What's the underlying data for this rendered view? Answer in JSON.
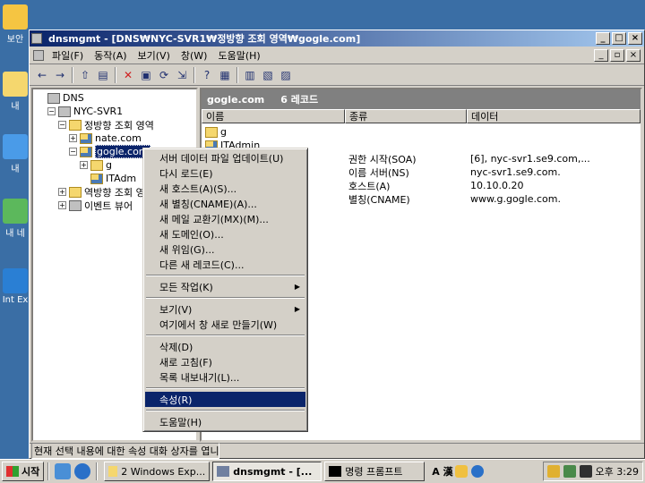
{
  "desktop": {
    "icons": [
      {
        "label": "보안",
        "color": "#f5c542"
      },
      {
        "label": "내",
        "color": "#f5d76e"
      },
      {
        "label": "내 ",
        "color": "#4a9be8"
      },
      {
        "label": "내 네",
        "color": "#5cb85c"
      },
      {
        "label": "Int Ex",
        "color": "#2a7fd4"
      }
    ]
  },
  "window": {
    "title": "dnsmgmt - [DNS₩NYC-SVR1₩정방향 조회 영역₩gogle.com]",
    "buttons": [
      "_",
      "□",
      "×"
    ]
  },
  "menubar": {
    "items": [
      "파일(F)",
      "동작(A)",
      "보기(V)",
      "창(W)",
      "도움말(H)"
    ],
    "mdi_buttons": [
      "_",
      "▫",
      "×"
    ]
  },
  "toolbar": {
    "icons": [
      "back-icon",
      "forward-icon",
      "up-folder-icon",
      "show-tree-icon",
      "delete-icon",
      "properties-icon",
      "refresh-icon",
      "export-icon",
      "help-icon",
      "console-icon",
      "server-icon",
      "records-icon",
      "zone-icon"
    ],
    "glyphs": [
      "←",
      "→",
      "⇧",
      "▤",
      "✕",
      "▣",
      "⟳",
      "⇲",
      "?",
      "▦",
      "▥",
      "▧",
      "▨"
    ],
    "separators_after": [
      1,
      3,
      7,
      9
    ]
  },
  "tree": {
    "nodes": [
      {
        "label": "DNS",
        "indent": 0,
        "expander": "",
        "icon": "dns-root-icon"
      },
      {
        "label": "NYC-SVR1",
        "indent": 1,
        "expander": "−",
        "icon": "server-icon"
      },
      {
        "label": "정방향 조회 영역",
        "indent": 2,
        "expander": "−",
        "icon": "folder-icon"
      },
      {
        "label": "nate.com",
        "indent": 3,
        "expander": "+",
        "icon": "zone-icon"
      },
      {
        "label": "gogle.com",
        "indent": 3,
        "expander": "−",
        "icon": "zone-icon",
        "selected": true
      },
      {
        "label": "g",
        "indent": 4,
        "expander": "+",
        "icon": "folder-icon"
      },
      {
        "label": "ITAdm",
        "indent": 4,
        "expander": "",
        "icon": "zone-icon"
      },
      {
        "label": "역방향 조회 영",
        "indent": 2,
        "expander": "+",
        "icon": "folder-icon"
      },
      {
        "label": "이벤트 뷰어",
        "indent": 2,
        "expander": "+",
        "icon": "event-viewer-icon"
      }
    ]
  },
  "right_pane": {
    "header_name": "gogle.com",
    "header_count": "6 레코드",
    "columns": [
      "이름",
      "종류",
      "데이터"
    ],
    "rows": [
      {
        "name": "g",
        "type": "",
        "data": "",
        "icon": "folder-icon"
      },
      {
        "name": "ITAdmin",
        "type": "",
        "data": "",
        "icon": "zone-icon"
      },
      {
        "name": "",
        "type": "권한 시작(SOA)",
        "data": "[6], nyc-svr1.se9.com,...",
        "icon": ""
      },
      {
        "name": "",
        "type": "이름 서버(NS)",
        "data": "nyc-svr1.se9.com.",
        "icon": ""
      },
      {
        "name": "",
        "type": "호스트(A)",
        "data": "10.10.0.20",
        "icon": ""
      },
      {
        "name": "",
        "type": "별칭(CNAME)",
        "data": "www.g.gogle.com.",
        "icon": ""
      }
    ]
  },
  "context_menu": {
    "groups": [
      [
        {
          "label": "서버 데이터 파일 업데이트(U)"
        },
        {
          "label": "다시 로드(E)"
        },
        {
          "label": "새 호스트(A)(S)..."
        },
        {
          "label": "새 별칭(CNAME)(A)..."
        },
        {
          "label": "새 메일 교환기(MX)(M)..."
        },
        {
          "label": "새 도메인(O)..."
        },
        {
          "label": "새 위임(G)..."
        },
        {
          "label": "다른 새 레코드(C)..."
        }
      ],
      [
        {
          "label": "모든 작업(K)",
          "submenu": true
        }
      ],
      [
        {
          "label": "보기(V)",
          "submenu": true
        },
        {
          "label": "여기에서 창 새로 만들기(W)"
        }
      ],
      [
        {
          "label": "삭제(D)"
        },
        {
          "label": "새로 고침(F)"
        },
        {
          "label": "목록 내보내기(L)..."
        }
      ],
      [
        {
          "label": "속성(R)",
          "highlight": true
        }
      ],
      [
        {
          "label": "도움말(H)"
        }
      ]
    ]
  },
  "statusbar": {
    "text": "현재 선택 내용에 대한 속성 대화 상자를 엽니다."
  },
  "taskbar": {
    "start_label": "시작",
    "tasks": [
      {
        "label": "2 Windows Exp...",
        "icon": "folder-icon",
        "active": false
      },
      {
        "label": "dnsmgmt - [...",
        "icon": "dnsmgmt-icon",
        "active": true
      },
      {
        "label": "명령 프롬프트",
        "icon": "cmd-icon",
        "active": false
      }
    ],
    "ime": "A 漢",
    "clock": "오후 3:29"
  },
  "colors": {
    "desktop": "#3a6ea5",
    "title_active": "#0a246a",
    "selection": "#0a246a"
  }
}
